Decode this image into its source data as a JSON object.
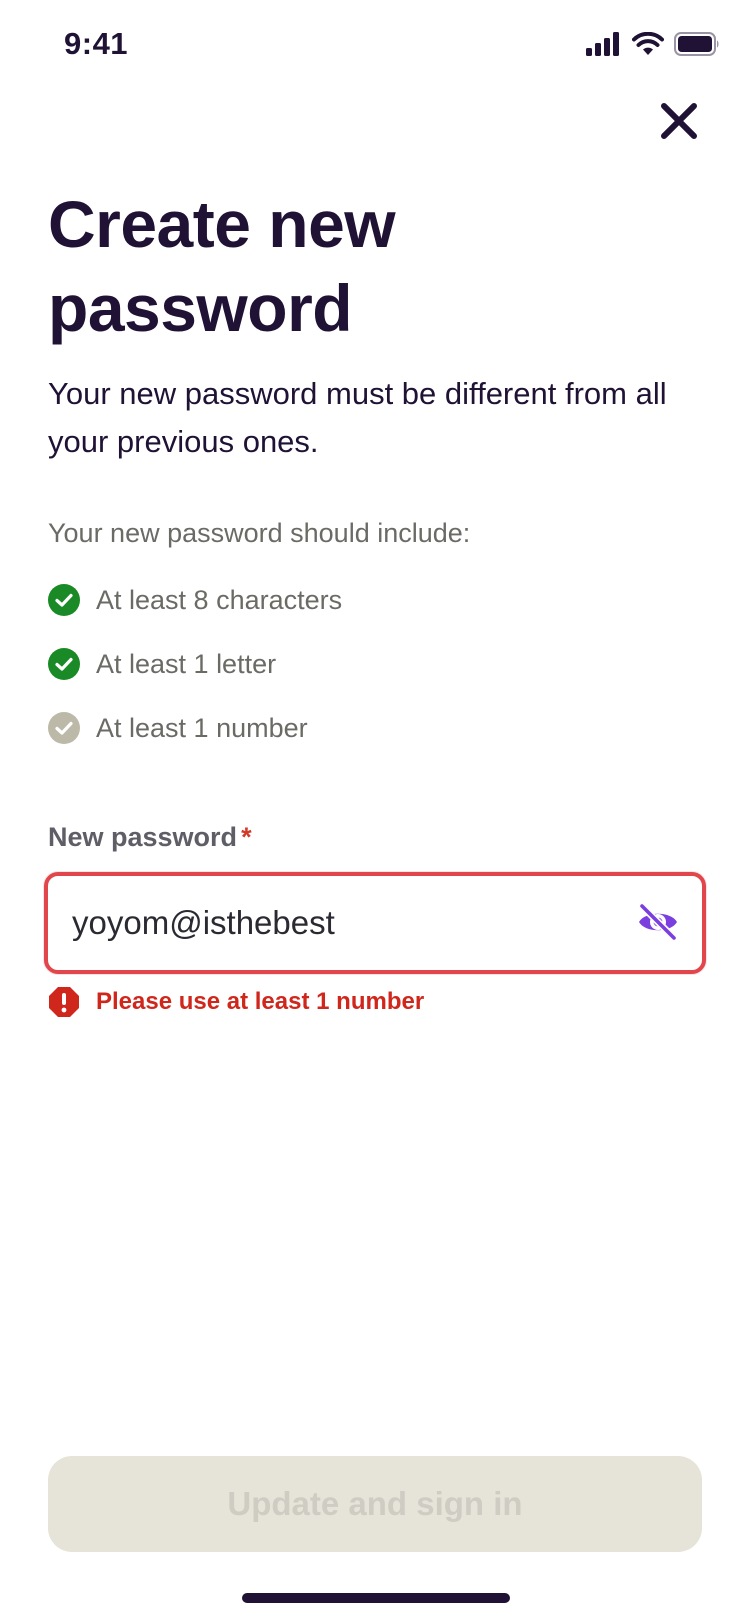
{
  "status_bar": {
    "time": "9:41",
    "icons": [
      "cellular-signal-icon",
      "wifi-icon",
      "battery-icon"
    ]
  },
  "close_icon": "close-icon",
  "title": "Create new password",
  "subtitle": "Your new password must be different from all your previous ones.",
  "requirements": {
    "heading": "Your new password should include:",
    "items": [
      {
        "label": "At least 8 characters",
        "met": true
      },
      {
        "label": "At least 1 letter",
        "met": true
      },
      {
        "label": "At least 1 number",
        "met": false
      }
    ]
  },
  "password_field": {
    "label": "New password",
    "required_marker": "*",
    "value": "yoyom@isthebest",
    "toggle_icon": "eye-off-icon"
  },
  "error": {
    "icon": "error-octagon-icon",
    "message": "Please use at least 1 number"
  },
  "submit": {
    "label": "Update and sign in",
    "enabled": false
  },
  "colors": {
    "text_primary": "#1f1235",
    "check_met": "#1a8a26",
    "check_unmet": "#bdb9a8",
    "error": "#d0271c",
    "input_border_error": "#e0464c",
    "accent": "#7b3fe0",
    "button_disabled_bg": "#e6e3d8",
    "button_disabled_text": "#cfccc4"
  }
}
